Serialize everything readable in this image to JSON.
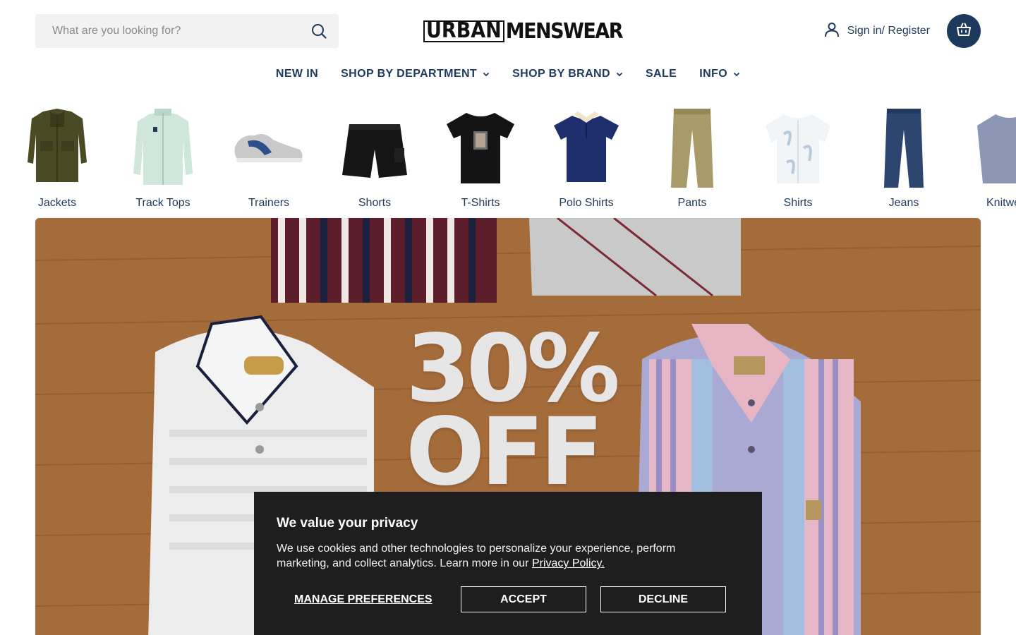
{
  "search": {
    "placeholder": "What are you looking for?",
    "icon": "search-icon"
  },
  "brand": {
    "logo_part1": "URBAN",
    "logo_part2": "MENSWEAR"
  },
  "account": {
    "signin_label": "Sign in/ Register",
    "icon": "user-icon"
  },
  "cart": {
    "icon": "shopping-bag-icon",
    "color": "#1d3a5c"
  },
  "nav": {
    "items": [
      {
        "label": "NEW IN",
        "has_dropdown": false
      },
      {
        "label": "SHOP BY DEPARTMENT",
        "has_dropdown": true
      },
      {
        "label": "SHOP BY BRAND",
        "has_dropdown": true
      },
      {
        "label": "SALE",
        "has_dropdown": false
      },
      {
        "label": "INFO",
        "has_dropdown": true
      }
    ]
  },
  "categories": [
    {
      "label": "Jackets",
      "icon": "jacket-image"
    },
    {
      "label": "Track Tops",
      "icon": "track-top-image"
    },
    {
      "label": "Trainers",
      "icon": "trainer-image"
    },
    {
      "label": "Shorts",
      "icon": "shorts-image"
    },
    {
      "label": "T-Shirts",
      "icon": "tshirt-image"
    },
    {
      "label": "Polo Shirts",
      "icon": "polo-image"
    },
    {
      "label": "Pants",
      "icon": "pants-image"
    },
    {
      "label": "Shirts",
      "icon": "shirt-image"
    },
    {
      "label": "Jeans",
      "icon": "jeans-image"
    },
    {
      "label": "Knitwear",
      "icon": "knitwear-image"
    }
  ],
  "hero": {
    "promo_line1": "30%",
    "promo_line2": "OFF"
  },
  "cookie_banner": {
    "title": "We value your privacy",
    "body": "We use cookies and other technologies to personalize your experience, perform marketing, and collect analytics. Learn more in our ",
    "policy_link": "Privacy Policy.",
    "manage_label": "MANAGE PREFERENCES",
    "accept_label": "ACCEPT",
    "decline_label": "DECLINE"
  },
  "colors": {
    "brand_navy": "#1d3a5c",
    "banner_bg": "#1e1e1e"
  }
}
